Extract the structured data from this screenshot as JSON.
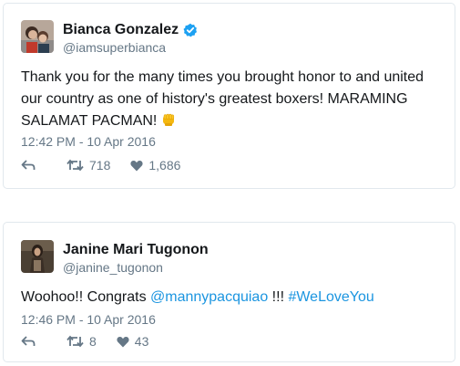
{
  "tweets": [
    {
      "display_name": "Bianca Gonzalez",
      "verified": true,
      "handle": "@iamsuperbianca",
      "text_line1": "Thank you for the many times you brought honor to and united",
      "text_line2": "our country as one of history's greatest boxers! MARAMING",
      "text_line3": "SALAMAT PACMAN!",
      "emoji": "fist-icon",
      "timestamp": "12:42 PM - 10 Apr 2016",
      "retweets": "718",
      "likes": "1,686"
    },
    {
      "display_name": "Janine Mari Tugonon",
      "verified": false,
      "handle": "@janine_tugonon",
      "text_prefix": "Woohoo!! Congrats ",
      "mention": "@mannypacquiao",
      "text_mid": " !!! ",
      "hashtag": "#WeLoveYou",
      "timestamp": "12:46 PM - 10 Apr 2016",
      "retweets": "8",
      "likes": "43"
    }
  ],
  "colors": {
    "text": "#14171a",
    "secondary": "#657786",
    "link": "#1b95e0",
    "verified": "#1da1f2",
    "border": "#e1e8ed"
  }
}
